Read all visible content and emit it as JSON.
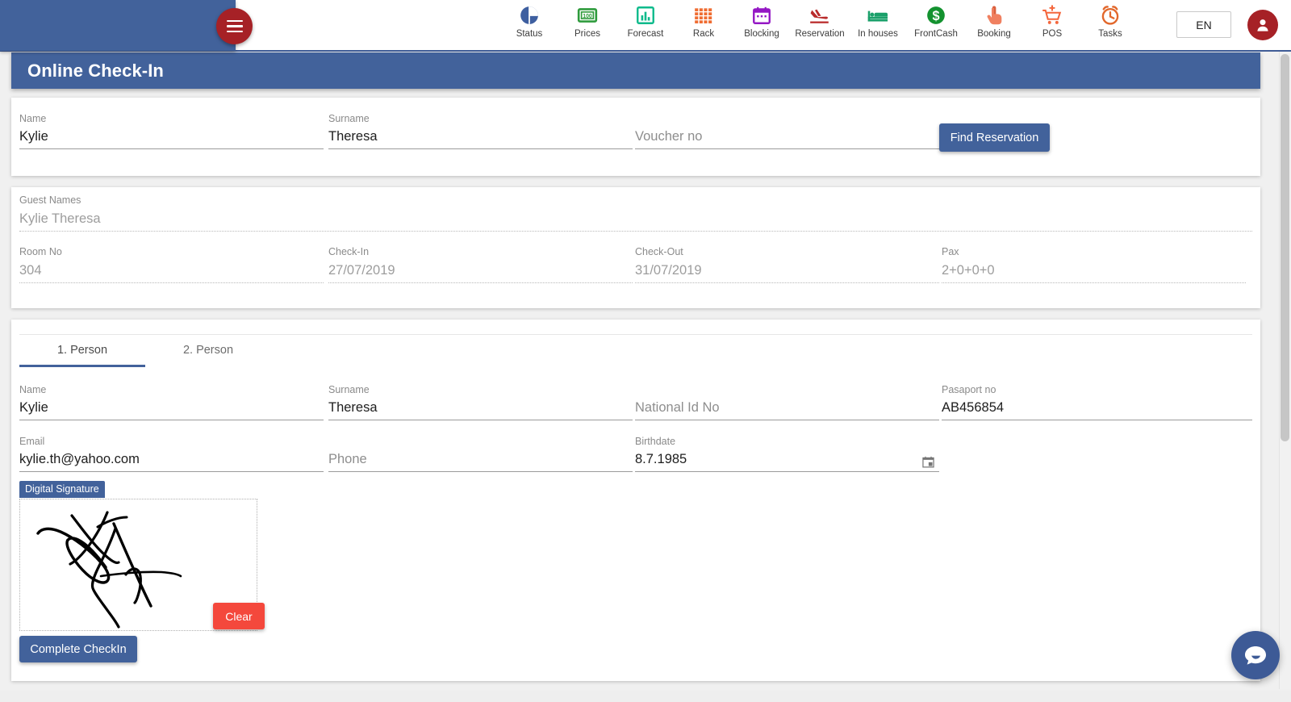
{
  "nav": {
    "hamburger": "menu-icon",
    "items": [
      {
        "label": "Status",
        "icon": "pie-chart-icon"
      },
      {
        "label": "Prices",
        "icon": "price-tag-100-icon"
      },
      {
        "label": "Forecast",
        "icon": "bar-chart-icon"
      },
      {
        "label": "Rack",
        "icon": "grid-icon"
      },
      {
        "label": "Blocking",
        "icon": "calendar-icon"
      },
      {
        "label": "Reservation",
        "icon": "airplane-landing-icon"
      },
      {
        "label": "In houses",
        "icon": "bed-icon"
      },
      {
        "label": "FrontCash",
        "icon": "dollar-coin-icon"
      },
      {
        "label": "Booking",
        "icon": "hand-pointer-icon"
      },
      {
        "label": "POS",
        "icon": "shopping-cart-plus-icon"
      },
      {
        "label": "Tasks",
        "icon": "alarm-clock-icon"
      }
    ],
    "language": "EN",
    "avatar": "user-account-icon"
  },
  "page": {
    "title": "Online Check-In"
  },
  "search": {
    "name": {
      "label": "Name",
      "value": "Kylie",
      "placeholder": ""
    },
    "surname": {
      "label": "Surname",
      "value": "Theresa",
      "placeholder": ""
    },
    "voucher": {
      "label": "",
      "value": "",
      "placeholder": "Voucher no"
    },
    "find_button": "Find Reservation"
  },
  "reservation": {
    "guest_names": {
      "label": "Guest Names",
      "value": "Kylie Theresa"
    },
    "room_no": {
      "label": "Room No",
      "value": "304"
    },
    "check_in": {
      "label": "Check-In",
      "value": "27/07/2019"
    },
    "check_out": {
      "label": "Check-Out",
      "value": "31/07/2019"
    },
    "pax": {
      "label": "Pax",
      "value": "2+0+0+0"
    }
  },
  "person": {
    "tabs": [
      {
        "label": "1. Person",
        "active": true
      },
      {
        "label": "2. Person",
        "active": false
      }
    ],
    "fields": {
      "name": {
        "label": "Name",
        "value": "Kylie",
        "placeholder": ""
      },
      "surname": {
        "label": "Surname",
        "value": "Theresa",
        "placeholder": ""
      },
      "national_id": {
        "label": "",
        "value": "",
        "placeholder": "National Id No"
      },
      "passport": {
        "label": "Pasaport no",
        "value": "AB456854",
        "placeholder": ""
      },
      "email": {
        "label": "Email",
        "value": "kylie.th@yahoo.com",
        "placeholder": ""
      },
      "phone": {
        "label": "",
        "value": "",
        "placeholder": "Phone"
      },
      "birthdate": {
        "label": "Birthdate",
        "value": "8.7.1985",
        "placeholder": ""
      }
    },
    "birthdate_picker_icon": "calendar-picker-icon",
    "signature": {
      "label": "Digital Signature",
      "clear_button": "Clear",
      "has_signature": true
    },
    "submit_button": "Complete CheckIn"
  },
  "chat": {
    "icon": "chat-bubble-smile-icon"
  },
  "colors": {
    "primary_blue": "#42629b",
    "accent_red": "#a62126",
    "danger_red": "#f4483c",
    "page_bg": "#f0f0f0"
  }
}
